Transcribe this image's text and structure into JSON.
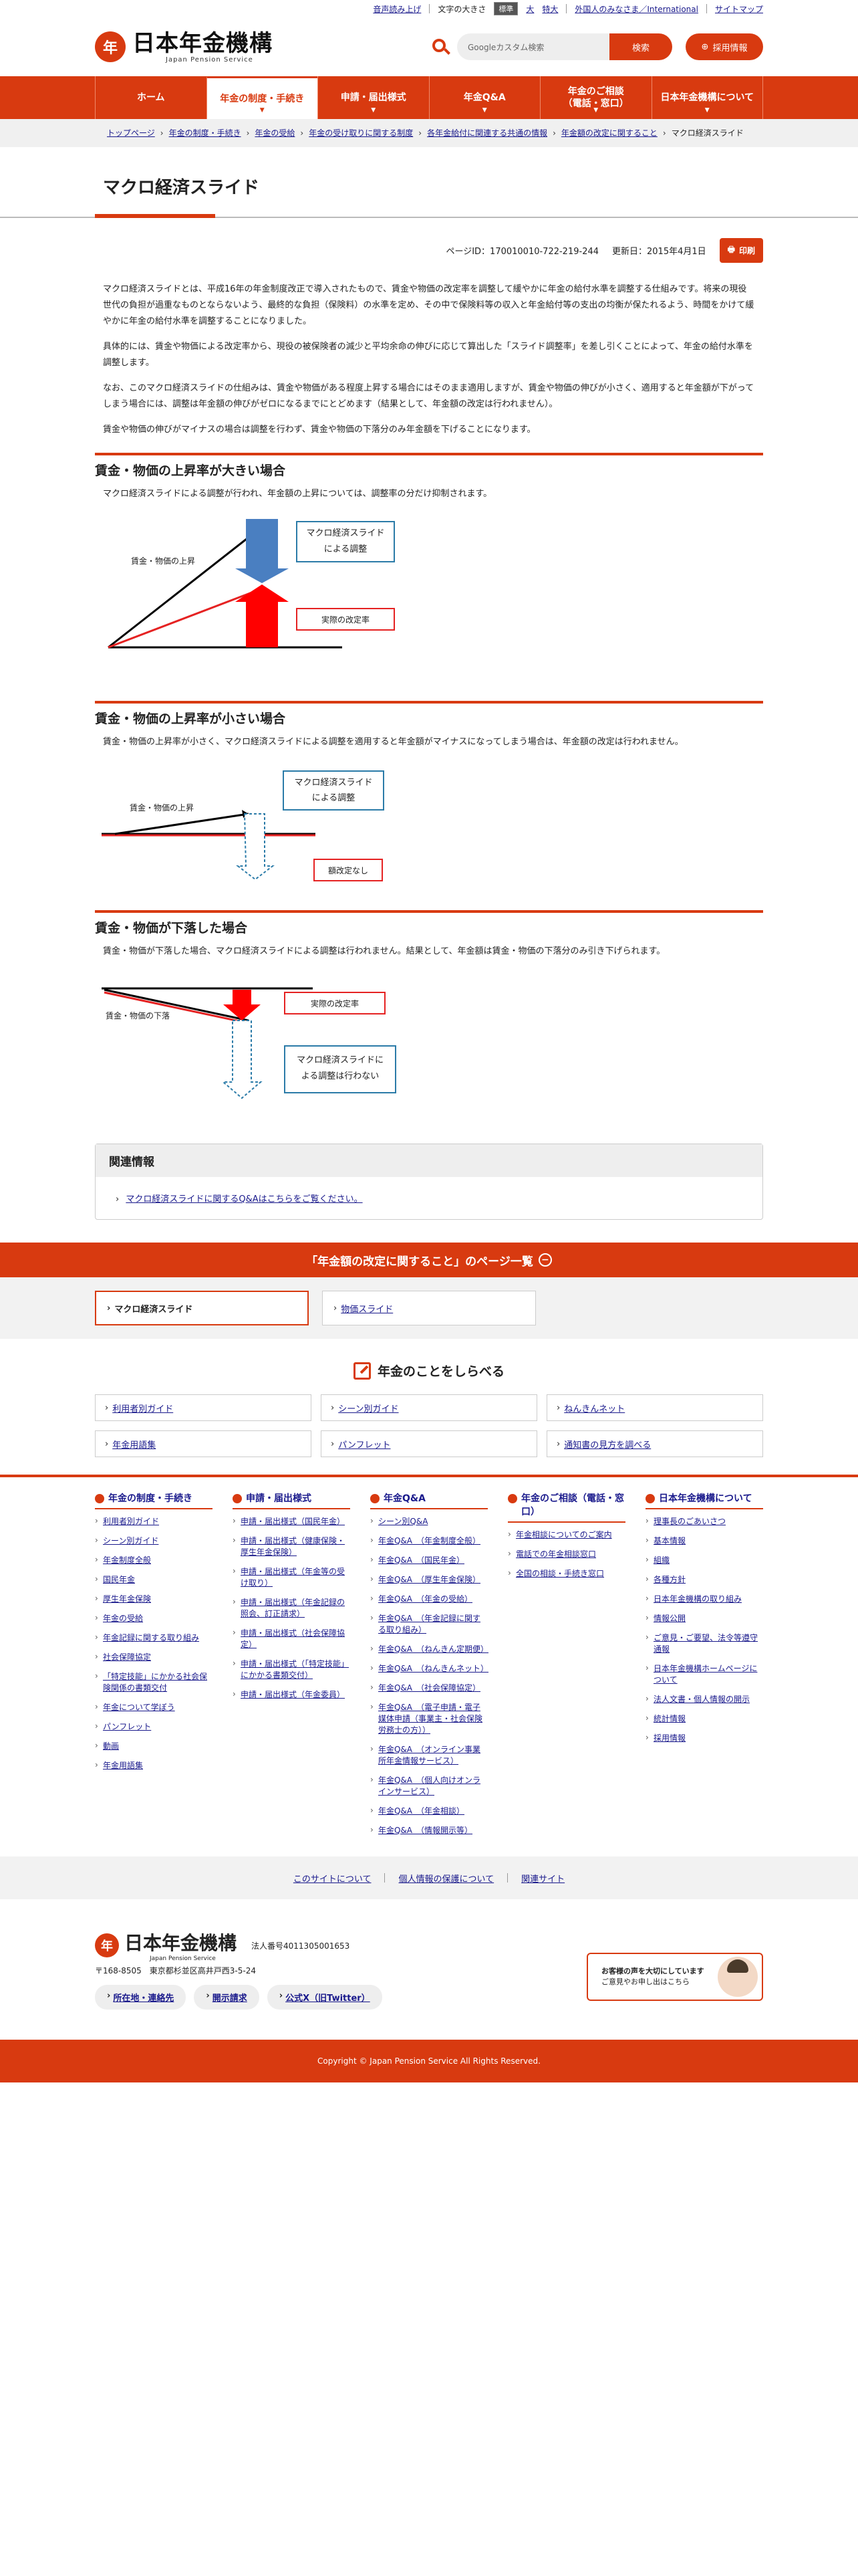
{
  "util": {
    "read_aloud": "音声読み上げ",
    "font_size_label": "文字の大きさ",
    "size_standard": "標準",
    "size_large": "大",
    "size_xlarge": "特大",
    "foreign": "外国人のみなさま／International",
    "sitemap": "サイトマップ"
  },
  "header": {
    "logo_jp": "日本年金機構",
    "logo_en": "Japan Pension Service",
    "logo_mark": "年",
    "search_placeholder": "Googleカスタム検索",
    "search_button": "検索",
    "recruit_button": "採用情報",
    "recruit_icon": "⊕"
  },
  "gnav": [
    {
      "label": "ホーム",
      "active": false
    },
    {
      "label": "年金の制度・手続き",
      "active": true
    },
    {
      "label": "申請・届出様式",
      "active": false
    },
    {
      "label": "年金Q&A",
      "active": false
    },
    {
      "label": "年金のご相談\n（電話・窓口）",
      "active": false
    },
    {
      "label": "日本年金機構について",
      "active": false
    }
  ],
  "breadcrumb": [
    "トップページ",
    "年金の制度・手続き",
    "年金の受給",
    "年金の受け取りに関する制度",
    "各年金給付に関連する共通の情報",
    "年金額の改定に関すること",
    "マクロ経済スライド"
  ],
  "page": {
    "title": "マクロ経済スライド",
    "page_id": "ページID：170010010-722-219-244",
    "updated": "更新日：2015年4月1日",
    "print": "印刷",
    "intro": [
      "マクロ経済スライドとは、平成16年の年金制度改正で導入されたもので、賃金や物価の改定率を調整して緩やかに年金の給付水準を調整する仕組みです。将来の現役世代の負担が過重なものとならないよう、最終的な負担（保険料）の水準を定め、その中で保険料等の収入と年金給付等の支出の均衡が保たれるよう、時間をかけて緩やかに年金の給付水準を調整することになりました。",
      "具体的には、賃金や物価による改定率から、現役の被保険者の減少と平均余命の伸びに応じて算出した「スライド調整率」を差し引くことによって、年金の給付水準を調整します。",
      "なお、このマクロ経済スライドの仕組みは、賃金や物価がある程度上昇する場合にはそのまま適用しますが、賃金や物価の伸びが小さく、適用すると年金額が下がってしまう場合には、調整は年金額の伸びがゼロになるまでにとどめます（結果として、年金額の改定は行われません）。",
      "賃金や物価の伸びがマイナスの場合は調整を行わず、賃金や物価の下落分のみ年金額を下げることになります。"
    ],
    "sections": [
      {
        "heading": "賃金・物価の上昇率が大きい場合",
        "text": "マクロ経済スライドによる調整が行われ、年金額の上昇については、調整率の分だけ抑制されます。",
        "label_line": "賃金・物価の上昇",
        "label_adjust": "マクロ経済スライド\nによる調整",
        "label_result": "実際の改定率"
      },
      {
        "heading": "賃金・物価の上昇率が小さい場合",
        "text": "賃金・物価の上昇率が小さく、マクロ経済スライドによる調整を適用すると年金額がマイナスになってしまう場合は、年金額の改定は行われません。",
        "label_line": "賃金・物価の上昇",
        "label_adjust": "マクロ経済スライド\nによる調整",
        "label_result": "額改定なし"
      },
      {
        "heading": "賃金・物価が下落した場合",
        "text": "賃金・物価が下落した場合、マクロ経済スライドによる調整は行われません。結果として、年金額は賃金・物価の下落分のみ引き下げられます。",
        "label_line": "賃金・物価の下落",
        "label_adjust": "マクロ経済スライドに\nよる調整は行わない",
        "label_result": "実際の改定率"
      }
    ]
  },
  "related": {
    "heading": "関連情報",
    "link": "マクロ経済スライドに関するQ&Aはこちらをご覧ください。"
  },
  "pagelist": {
    "title": "「年金額の改定に関すること」のページ一覧",
    "items": [
      "マクロ経済スライド",
      "物価スライド"
    ]
  },
  "lookup": {
    "title": "年金のことをしらべる",
    "items": [
      "利用者別ガイド",
      "シーン別ガイド",
      "ねんきんネット",
      "年金用語集",
      "パンフレット",
      "通知書の見方を調べる"
    ]
  },
  "footer_nav": [
    {
      "heading": "年金の制度・手続き",
      "items": [
        "利用者別ガイド",
        "シーン別ガイド",
        "年金制度全般",
        "国民年金",
        "厚生年金保険",
        "年金の受給",
        "年金記録に関する取り組み",
        "社会保障協定",
        "「特定技能」にかかる社会保険関係の書類交付",
        "年金について学ぼう",
        "パンフレット",
        "動画",
        "年金用語集"
      ]
    },
    {
      "heading": "申請・届出様式",
      "items": [
        "申請・届出様式（国民年金）",
        "申請・届出様式（健康保険・厚生年金保険）",
        "申請・届出様式（年金等の受け取り）",
        "申請・届出様式（年金記録の照会、訂正請求）",
        "申請・届出様式（社会保障協定）",
        "申請・届出様式（「特定技能」にかかる書類交付）",
        "申請・届出様式（年金委員）"
      ]
    },
    {
      "heading": "年金Q&A",
      "items": [
        "シーン別Q&A",
        "年金Q&A　（年金制度全般）",
        "年金Q&A　（国民年金）",
        "年金Q&A　（厚生年金保険）",
        "年金Q&A　（年金の受給）",
        "年金Q&A　（年金記録に関する取り組み）",
        "年金Q&A　（ねんきん定期便）",
        "年金Q&A　（ねんきんネット）",
        "年金Q&A　（社会保障協定）",
        "年金Q&A　（電子申請・電子媒体申請（事業主・社会保険労務士の方））",
        "年金Q&A　（オンライン事業所年金情報サービス）",
        "年金Q&A　（個人向けオンラインサービス）",
        "年金Q&A　（年金相談）",
        "年金Q&A　（情報開示等）"
      ]
    },
    {
      "heading": "年金のご相談（電話・窓口）",
      "items": [
        "年金相談についてのご案内",
        "電話での年金相談窓口",
        "全国の相談・手続き窓口"
      ]
    },
    {
      "heading": "日本年金機構について",
      "items": [
        "理事長のごあいさつ",
        "基本情報",
        "組織",
        "各種方針",
        "日本年金機構の取り組み",
        "情報公開",
        "ご意見・ご要望、法令等遵守通報",
        "日本年金機構ホームページについて",
        "法人文書・個人情報の開示",
        "統計情報",
        "採用情報"
      ]
    }
  ],
  "sub_links": [
    "このサイトについて",
    "個人情報の保護について",
    "関連サイト"
  ],
  "footer": {
    "logo_jp": "日本年金機構",
    "logo_en": "Japan Pension Service",
    "corp_no": "法人番号4011305001653",
    "address": "〒168-8505　東京都杉並区高井戸西3-5-24",
    "buttons": [
      "所在地・連絡先",
      "開示請求",
      "公式X（旧Twitter）"
    ],
    "voice_line1": "お客様の声を大切にしています",
    "voice_line2": "ご意見やお申し出はこちら",
    "copyright": "Copyright © Japan Pension Service All Rights Reserved."
  },
  "colors": {
    "accent": "#d83a10",
    "link": "#1a1a8c",
    "blue_arrow": "#4a7fc1",
    "red_arrow": "#e52222"
  }
}
